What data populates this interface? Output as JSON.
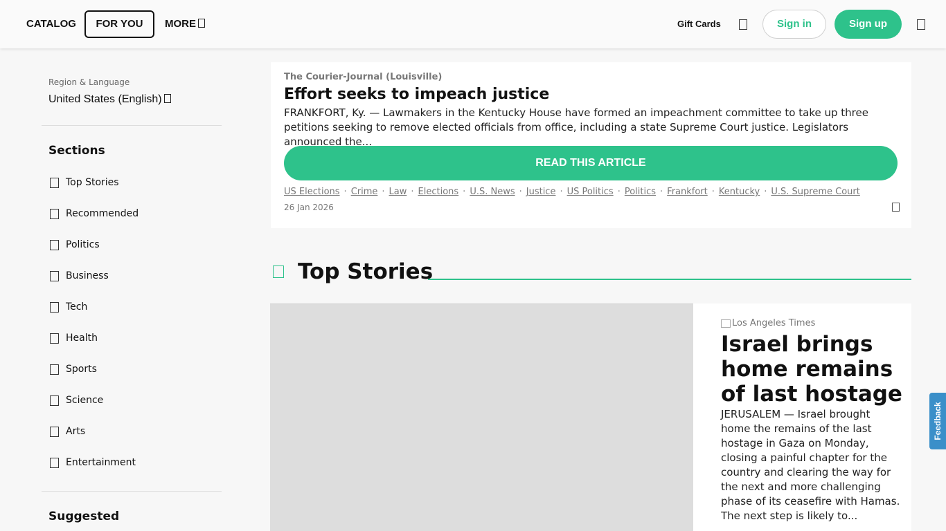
{
  "header": {
    "catalog": "CATALOG",
    "for_you": "FOR YOU",
    "more": "MORE",
    "gift_cards": "Gift Cards",
    "sign_in": "Sign in",
    "sign_up": "Sign up"
  },
  "sidebar": {
    "region_label": "Region & Language",
    "region_value": "United States (English)",
    "sections_title": "Sections",
    "sections": [
      {
        "label": "Top Stories"
      },
      {
        "label": "Recommended"
      },
      {
        "label": "Politics"
      },
      {
        "label": "Business"
      },
      {
        "label": "Tech"
      },
      {
        "label": "Health"
      },
      {
        "label": "Sports"
      },
      {
        "label": "Science"
      },
      {
        "label": "Arts"
      },
      {
        "label": "Entertainment"
      }
    ],
    "suggested_title": "Suggested"
  },
  "article": {
    "source": "The Courier-Journal (Louisville)",
    "title": "Effort seeks to impeach justice",
    "body": "FRANKFORT, Ky. — Lawmakers in the Kentucky House have formed an impeachment committee to take up three petitions seeking to remove elected officials from office, including a state Supreme Court justice. Legislators announced the...",
    "read_label": "READ THIS ARTICLE",
    "tags": [
      "US Elections",
      "Crime",
      "Law",
      "Elections",
      "U.S. News",
      "Justice",
      "US Politics",
      "Politics",
      "Frankfort",
      "Kentucky",
      "U.S. Supreme Court"
    ],
    "date": "26 Jan 2026"
  },
  "top_stories": {
    "title": "Top Stories",
    "story": {
      "source": "Los Angeles Times",
      "title": "Israel brings home remains of last hostage",
      "body": "JERUSALEM — Israel brought home the remains of the last hostage in Gaza on Monday, closing a painful chapter for the country and clearing the way for the next and more chal­lenging phase of its ceasefire with Hamas. The next step is likely to..."
    }
  },
  "feedback_label": "Feedback",
  "colors": {
    "accent": "#2ec28b",
    "feedback": "#3a8fc9"
  }
}
